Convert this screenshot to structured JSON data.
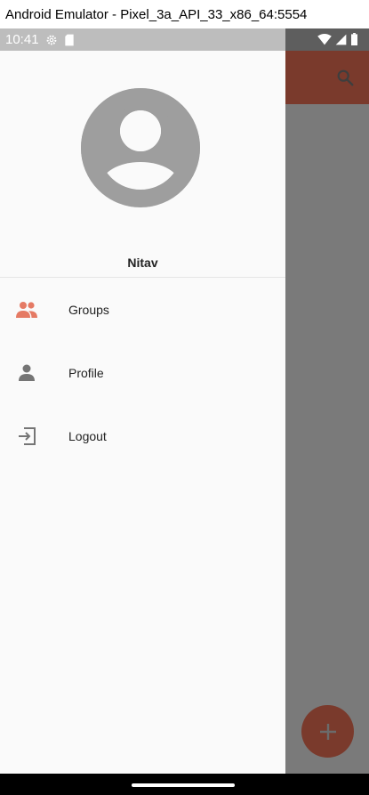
{
  "window": {
    "title": "Android Emulator - Pixel_3a_API_33_x86_64:5554"
  },
  "status_bar": {
    "time": "10:41",
    "left_icons": [
      "settings-gear-icon",
      "sd-card-icon"
    ],
    "right_icons": [
      "wifi-icon",
      "signal-icon",
      "battery-icon"
    ]
  },
  "app_bar": {
    "search_icon": "search-icon",
    "accent": "#7a3a2c"
  },
  "drawer": {
    "user_name": "Nitav",
    "items": [
      {
        "label": "Groups",
        "icon": "groups-icon",
        "active": true
      },
      {
        "label": "Profile",
        "icon": "person-icon",
        "active": false
      },
      {
        "label": "Logout",
        "icon": "logout-icon",
        "active": false
      }
    ]
  },
  "fab": {
    "icon": "plus-icon"
  },
  "colors": {
    "accent": "#e57a64",
    "icon_gray": "#757575",
    "scrim": "#7a7a7a"
  }
}
